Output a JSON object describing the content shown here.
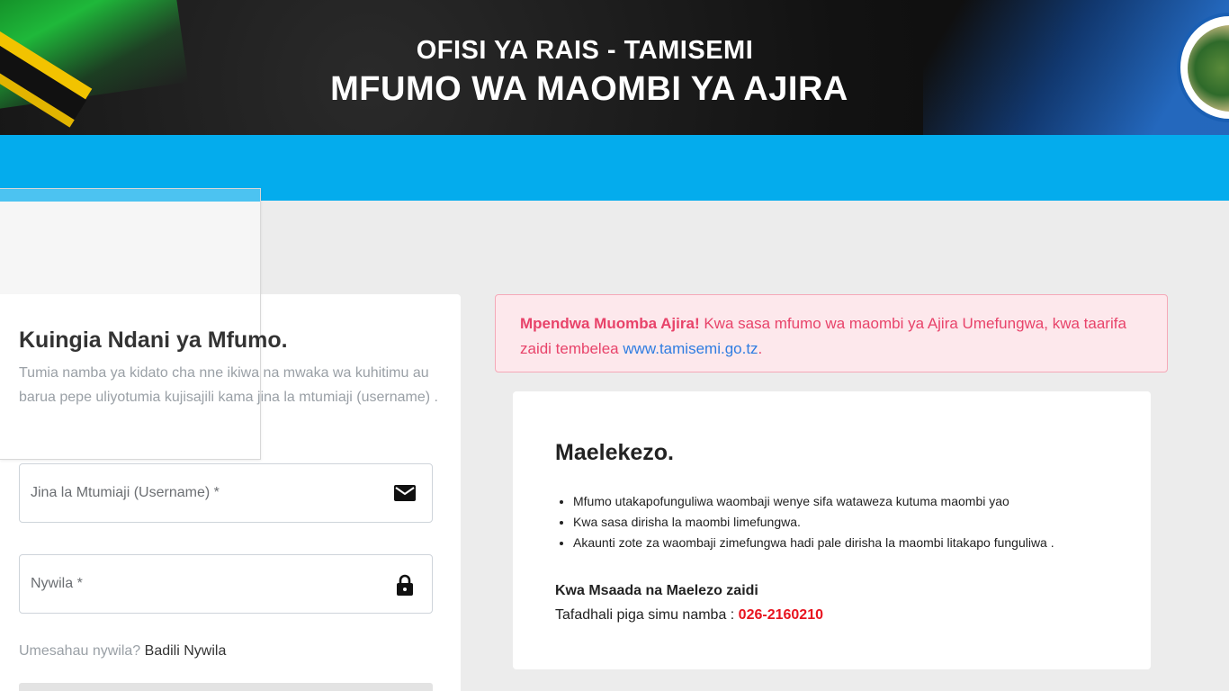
{
  "header": {
    "subtitle": "OFISI YA RAIS - TAMISEMI",
    "title": "MFUMO WA MAOMBI YA AJIRA",
    "logo_icon": "coat-of-arms-icon",
    "flag_icon": "tanzania-flag-icon",
    "accent_color": "#04aced"
  },
  "login": {
    "title": "Kuingia Ndani ya Mfumo.",
    "description": "Tumia namba ya kidato cha nne ikiwa na mwaka wa kuhitimu au barua pepe uliyotumia kujisajili kama jina la mtumiaji (username) .",
    "username_placeholder": "Jina la Mtumiaji (Username) *",
    "username_value": "",
    "username_icon": "mail-icon",
    "password_placeholder": "Nywila *",
    "password_value": "",
    "password_icon": "lock-icon",
    "forgot_text": "Umesahau nywila?",
    "forgot_link": "Badili Nywila"
  },
  "alert": {
    "bold": "Mpendwa Muomba Ajira!",
    "text": " Kwa sasa mfumo wa maombi ya Ajira Umefungwa, kwa taarifa zaidi tembelea ",
    "link": "www.tamisemi.go.tz",
    "end": "."
  },
  "instructions": {
    "title": "Maelekezo.",
    "items": [
      "Mfumo utakapofunguliwa waombaji wenye sifa wataweza kutuma maombi yao",
      "Kwa sasa dirisha la maombi limefungwa.",
      "Akaunti zote za waombaji zimefungwa hadi pale dirisha la maombi litakapo funguliwa ."
    ],
    "help_title": "Kwa Msaada na Maelezo zaidi",
    "help_text": "Tafadhali piga simu namba : ",
    "phone": "026-2160210"
  }
}
